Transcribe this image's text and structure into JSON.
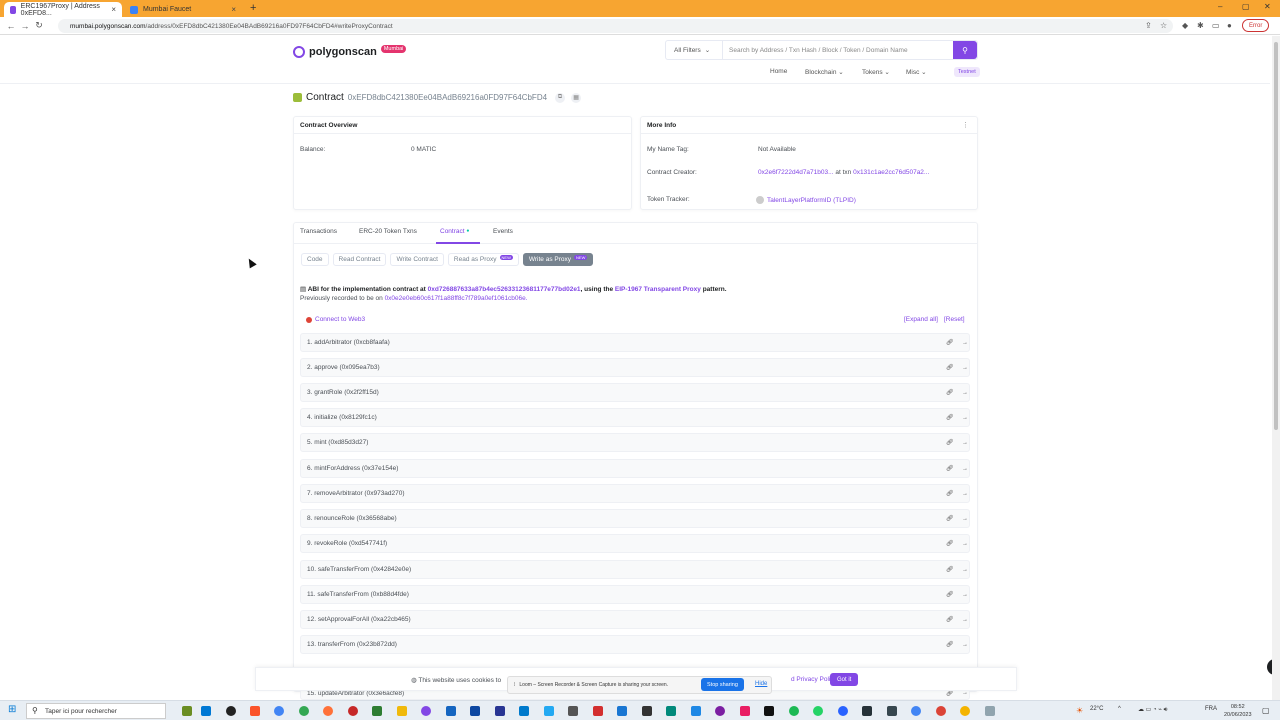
{
  "browser": {
    "tabs": [
      {
        "label": "ERC1967Proxy | Address 0xEFD8...",
        "active": true
      },
      {
        "label": "Mumbai Faucet",
        "active": false
      }
    ],
    "url_host": "mumbai.polygonscan.com",
    "url_path": "/address/0xEFD8dbC421380Ee04BAdB69216a0FD97F64CbFD4#writeProxyContract",
    "error_label": "Error"
  },
  "header": {
    "logo_text": "polygonscan",
    "logo_badge": "Mumbai",
    "filter_label": "All Filters",
    "search_placeholder": "Search by Address / Txn Hash / Block / Token / Domain Name",
    "nav": [
      "Home",
      "Blockchain",
      "Tokens",
      "Misc"
    ],
    "testnet": "Testnet"
  },
  "title": {
    "label": "Contract",
    "address": "0xEFD8dbC421380Ee04BAdB69216a0FD97F64CbFD4"
  },
  "overview": {
    "heading": "Contract Overview",
    "balance_label": "Balance:",
    "balance_value": "0 MATIC"
  },
  "more_info": {
    "heading": "More Info",
    "name_tag_label": "My Name Tag:",
    "name_tag_value": "Not Available",
    "creator_label": "Contract Creator:",
    "creator_addr": "0x2e6f7222d4d7a71b03...",
    "creator_at": "at txn",
    "creator_txn": "0x131c1ae2cc76d507a2...",
    "tracker_label": "Token Tracker:",
    "tracker_value": "TalentLayerPlatformID (TLPID)"
  },
  "tabs": [
    "Transactions",
    "ERC-20 Token Txns",
    "Contract",
    "Events"
  ],
  "subtabs": [
    {
      "label": "Code",
      "new": false,
      "active": false
    },
    {
      "label": "Read Contract",
      "new": false,
      "active": false
    },
    {
      "label": "Write Contract",
      "new": false,
      "active": false
    },
    {
      "label": "Read as Proxy",
      "new": true,
      "active": false
    },
    {
      "label": "Write as Proxy",
      "new": true,
      "active": true
    }
  ],
  "new_badge": "NEW",
  "abi": {
    "prefix": "ABI for the implementation contract at",
    "impl_addr": "0xd726887633a87b4ec52633123681177e77bd02e1",
    "middle": ", using the",
    "pattern_link": "EIP-1967 Transparent Proxy",
    "suffix": "pattern.",
    "prev_prefix": "Previously recorded to be on",
    "prev_addr": "0x0e2e0eb60c617f1a88ff8c7f789a0ef1061cb06e."
  },
  "connect_label": "Connect to Web3",
  "expand_all": "[Expand all]",
  "reset": "[Reset]",
  "functions": [
    "1. addArbitrator (0xcb8faafa)",
    "2. approve (0x095ea7b3)",
    "3. grantRole (0x2f2ff15d)",
    "4. initialize (0x8129fc1c)",
    "5. mint (0xd85d3d27)",
    "6. mintForAddress (0x37e154e)",
    "7. removeArbitrator (0x973ad270)",
    "8. renounceRole (0x36568abe)",
    "9. revokeRole (0xd547741f)",
    "10. safeTransferFrom (0x42842e0e)",
    "11. safeTransferFrom (0xb88d4fde)",
    "12. setApprovalForAll (0xa22cb465)",
    "13. transferFrom (0x23b872dd)",
    "15. updateArbitrator (0x3e6acfe8)"
  ],
  "cookie": {
    "text": "This website uses cookies to",
    "privacy": "d Privacy Policy.",
    "got_it": "Got it"
  },
  "loom": {
    "text": "Loom – Screen Recorder & Screen Capture is sharing your screen.",
    "stop": "Stop sharing",
    "hide": "Hide"
  },
  "taskbar": {
    "search": "Taper ici pour rechercher",
    "weather": "22°C",
    "lang": "FRA",
    "time": "08:52",
    "date": "20/06/2023"
  }
}
